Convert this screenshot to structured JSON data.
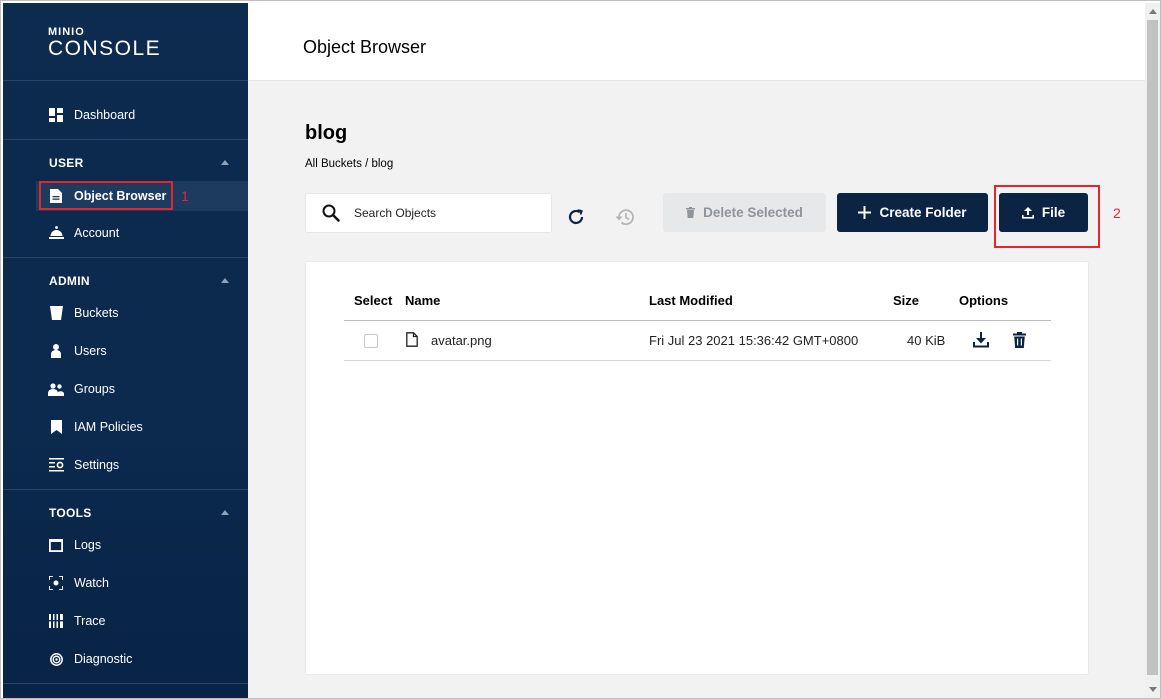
{
  "logo": {
    "brand": "MINIO",
    "product": "CONSOLE"
  },
  "sidebar": {
    "dashboard": "Dashboard",
    "user_section": "USER",
    "user_items": [
      "Object Browser",
      "Account"
    ],
    "admin_section": "ADMIN",
    "admin_items": [
      "Buckets",
      "Users",
      "Groups",
      "IAM Policies",
      "Settings"
    ],
    "tools_section": "TOOLS",
    "tools_items": [
      "Logs",
      "Watch",
      "Trace",
      "Diagnostic"
    ]
  },
  "header": {
    "title": "Object Browser"
  },
  "bucket": {
    "name": "blog",
    "breadcrumb": "All Buckets / blog"
  },
  "search": {
    "placeholder": "Search Objects"
  },
  "actions": {
    "delete_selected": "Delete Selected",
    "create_folder": "Create Folder",
    "upload_file": "File"
  },
  "annotations": {
    "one": "1",
    "two": "2"
  },
  "table": {
    "columns": [
      "Select",
      "Name",
      "Last Modified",
      "Size",
      "Options"
    ],
    "rows": [
      {
        "name": "avatar.png",
        "last_modified": "Fri Jul 23 2021 15:36:42 GMT+0800",
        "size": "40 KiB"
      }
    ]
  },
  "colors": {
    "sidebar": "#0d2a4f",
    "primary": "#0c2444",
    "highlight": "#e3262d"
  }
}
